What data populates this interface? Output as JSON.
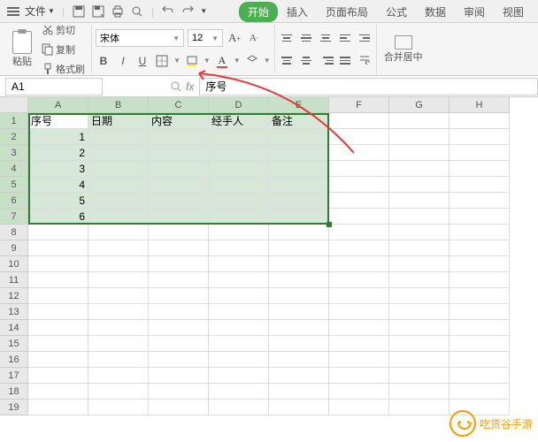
{
  "menu": {
    "file_label": "文件"
  },
  "tabs": {
    "start": "开始",
    "insert": "插入",
    "layout": "页面布局",
    "formula": "公式",
    "data": "数据",
    "review": "审阅",
    "view": "视图"
  },
  "clipboard": {
    "paste": "粘贴",
    "cut": "剪切",
    "copy": "复制",
    "format_painter": "格式刷"
  },
  "font": {
    "name": "宋体",
    "size": "12"
  },
  "merge": {
    "label": "合并居中"
  },
  "name_box": {
    "value": "A1"
  },
  "formula": {
    "fx": "fx",
    "value": "序号"
  },
  "columns": [
    "A",
    "B",
    "C",
    "D",
    "E",
    "F",
    "G",
    "H"
  ],
  "rows": [
    "1",
    "2",
    "3",
    "4",
    "5",
    "6",
    "7",
    "8",
    "9",
    "10",
    "11",
    "12",
    "13",
    "14",
    "15",
    "16",
    "17",
    "18",
    "19"
  ],
  "headers": {
    "col1": "序号",
    "col2": "日期",
    "col3": "内容",
    "col4": "经手人",
    "col5": "备注"
  },
  "serial": {
    "r2": "1",
    "r3": "2",
    "r4": "3",
    "r5": "4",
    "r6": "5",
    "r7": "6"
  },
  "watermark": {
    "text": "吃货谷手游"
  }
}
